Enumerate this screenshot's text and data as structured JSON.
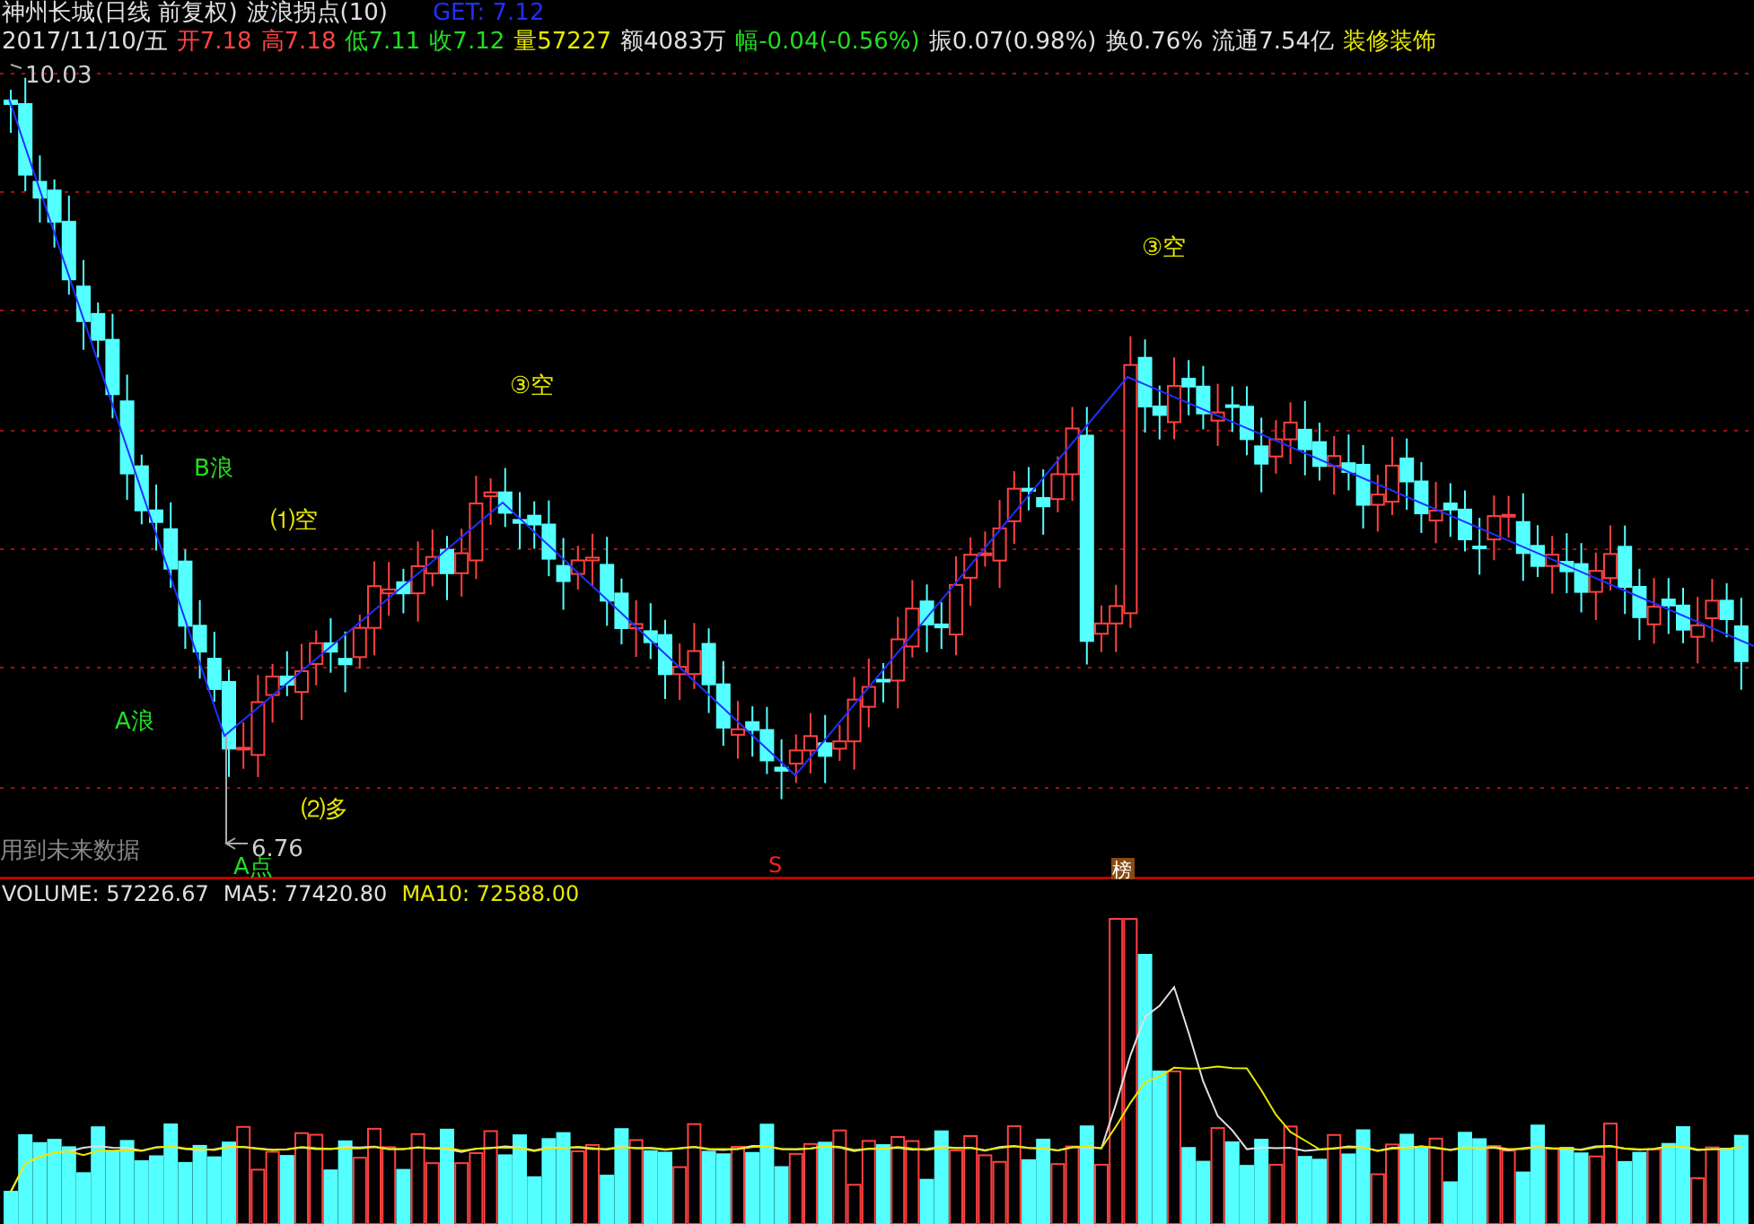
{
  "title": {
    "stock": "神州长城(日线 前复权)",
    "indicator": "波浪拐点(10)",
    "get": "GET: 7.12"
  },
  "quote": [
    {
      "text": "2017/11/10/五",
      "color": "#e0e0e0"
    },
    {
      "text": "开7.18",
      "color": "#ff4444"
    },
    {
      "text": "高7.18",
      "color": "#ff4444"
    },
    {
      "text": "低7.11",
      "color": "#22dd22"
    },
    {
      "text": "收7.12",
      "color": "#22dd22"
    },
    {
      "text": "量57227",
      "color": "#e8e800"
    },
    {
      "text": "额4083万",
      "color": "#e0e0e0"
    },
    {
      "text": "幅-0.04(-0.56%)",
      "color": "#22dd22"
    },
    {
      "text": "振0.07(0.98%)",
      "color": "#e0e0e0"
    },
    {
      "text": "换0.76%",
      "color": "#e0e0e0"
    },
    {
      "text": "流通7.54亿",
      "color": "#e0e0e0"
    },
    {
      "text": "装修装饰",
      "color": "#e8e800"
    }
  ],
  "price_chart": {
    "labels": [
      {
        "text": "10.03",
        "kind": "high"
      },
      {
        "text": "6.76",
        "kind": "low"
      },
      {
        "text": "A点",
        "kind": "wave"
      },
      {
        "text": "B浪",
        "kind": "wave"
      },
      {
        "text": "A浪",
        "kind": "wave"
      },
      {
        "text": "⑴空",
        "kind": "signal"
      },
      {
        "text": "⑵多",
        "kind": "signal"
      },
      {
        "text": "③空",
        "kind": "signal"
      },
      {
        "text": "③空",
        "kind": "signal"
      }
    ],
    "notice": "用到未来数据",
    "markers": [
      {
        "text": "S",
        "kind": "sell"
      },
      {
        "text": "榜",
        "kind": "list"
      }
    ]
  },
  "volume_chart": {
    "legend": [
      {
        "text": "VOLUME: 57226.67",
        "color": "#e0e0e0"
      },
      {
        "text": "MA5: 77420.80",
        "color": "#e0e0e0"
      },
      {
        "text": "MA10: 72588.00",
        "color": "#e8e800"
      }
    ]
  }
}
